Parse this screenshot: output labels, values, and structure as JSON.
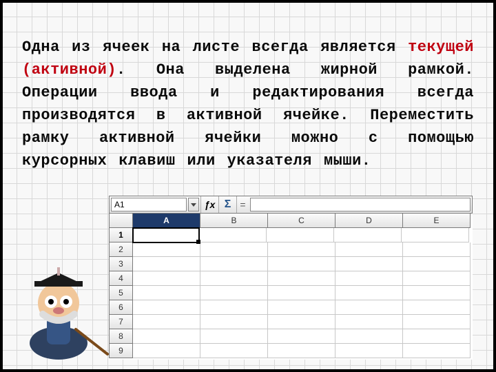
{
  "paragraph": {
    "p1a": "Одна из ячеек на листе всегда является ",
    "p1b_term": "текущей (активной)",
    "p1c": ". Она выделена жирной рамкой. Операции ввода и редактирования всегда производятся в активной ячейке. Переместить рамку активной ячейки можно с помощью курсорных клавиш или указателя мыши."
  },
  "spreadsheet": {
    "name_box": "A1",
    "fx_label": "ƒx",
    "sigma_label": "Σ",
    "equals_label": "=",
    "formula_value": "",
    "columns": [
      "A",
      "B",
      "C",
      "D",
      "E"
    ],
    "active_col_index": 0,
    "rows": [
      "1",
      "2",
      "3",
      "4",
      "5",
      "6",
      "7",
      "8",
      "9"
    ],
    "active_row_index": 0
  },
  "mascot": {
    "alt": "Cartoon professor with graduation cap and pointer stick"
  }
}
